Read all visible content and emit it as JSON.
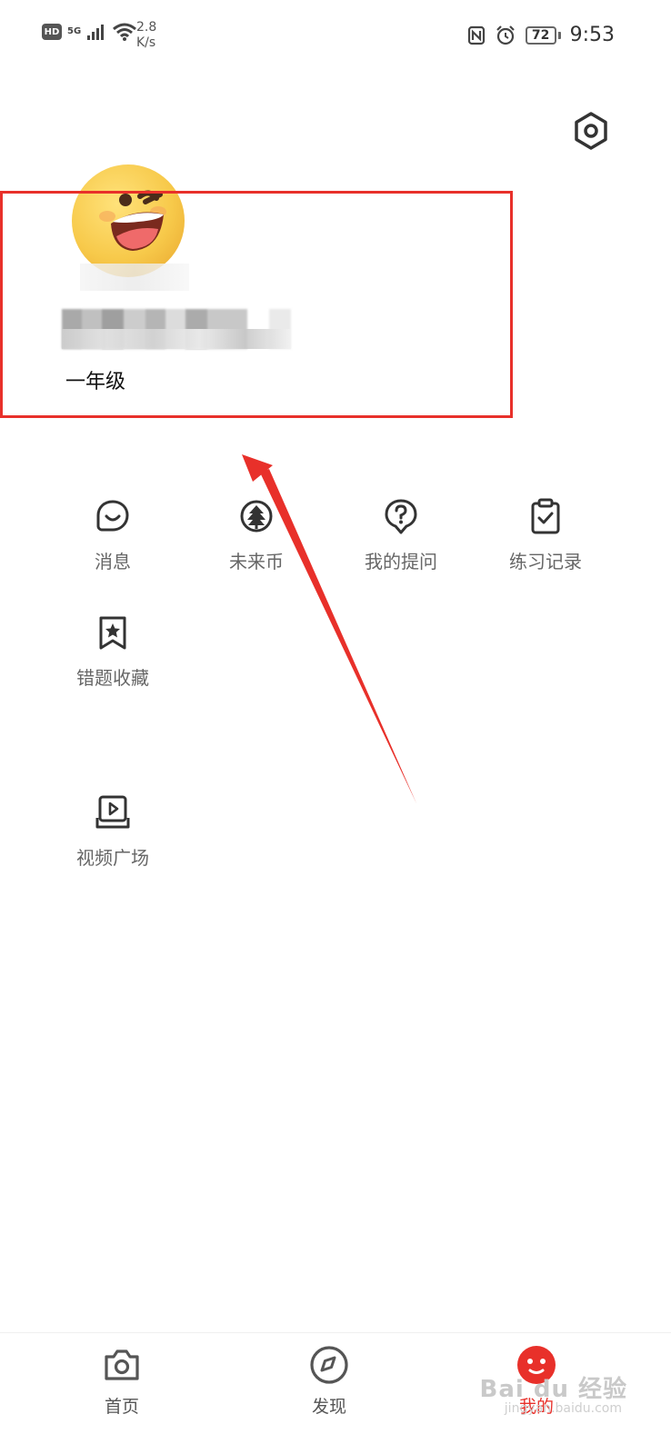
{
  "status_bar": {
    "hd": "HD",
    "network": "5G",
    "speed_value": "2.8",
    "speed_unit": "K/s",
    "battery": "72",
    "time": "9:53"
  },
  "profile": {
    "grade": "一年级"
  },
  "menu": {
    "items": [
      {
        "label": "消息",
        "icon": "message-icon"
      },
      {
        "label": "未来币",
        "icon": "coin-icon"
      },
      {
        "label": "我的提问",
        "icon": "question-icon"
      },
      {
        "label": "练习记录",
        "icon": "clipboard-check-icon"
      },
      {
        "label": "错题收藏",
        "icon": "bookmark-star-icon"
      },
      {
        "label": "视频广场",
        "icon": "video-icon"
      }
    ]
  },
  "bottom_nav": {
    "items": [
      {
        "label": "首页",
        "icon": "camera-icon"
      },
      {
        "label": "发现",
        "icon": "compass-icon"
      },
      {
        "label": "我的",
        "icon": "profile-icon",
        "active": true
      }
    ]
  },
  "watermark": {
    "brand": "Bai du 经验",
    "url": "jingyan.baidu.com"
  },
  "colors": {
    "accent": "#e8302a",
    "text_secondary": "#666666",
    "icon_stroke": "#333333"
  }
}
